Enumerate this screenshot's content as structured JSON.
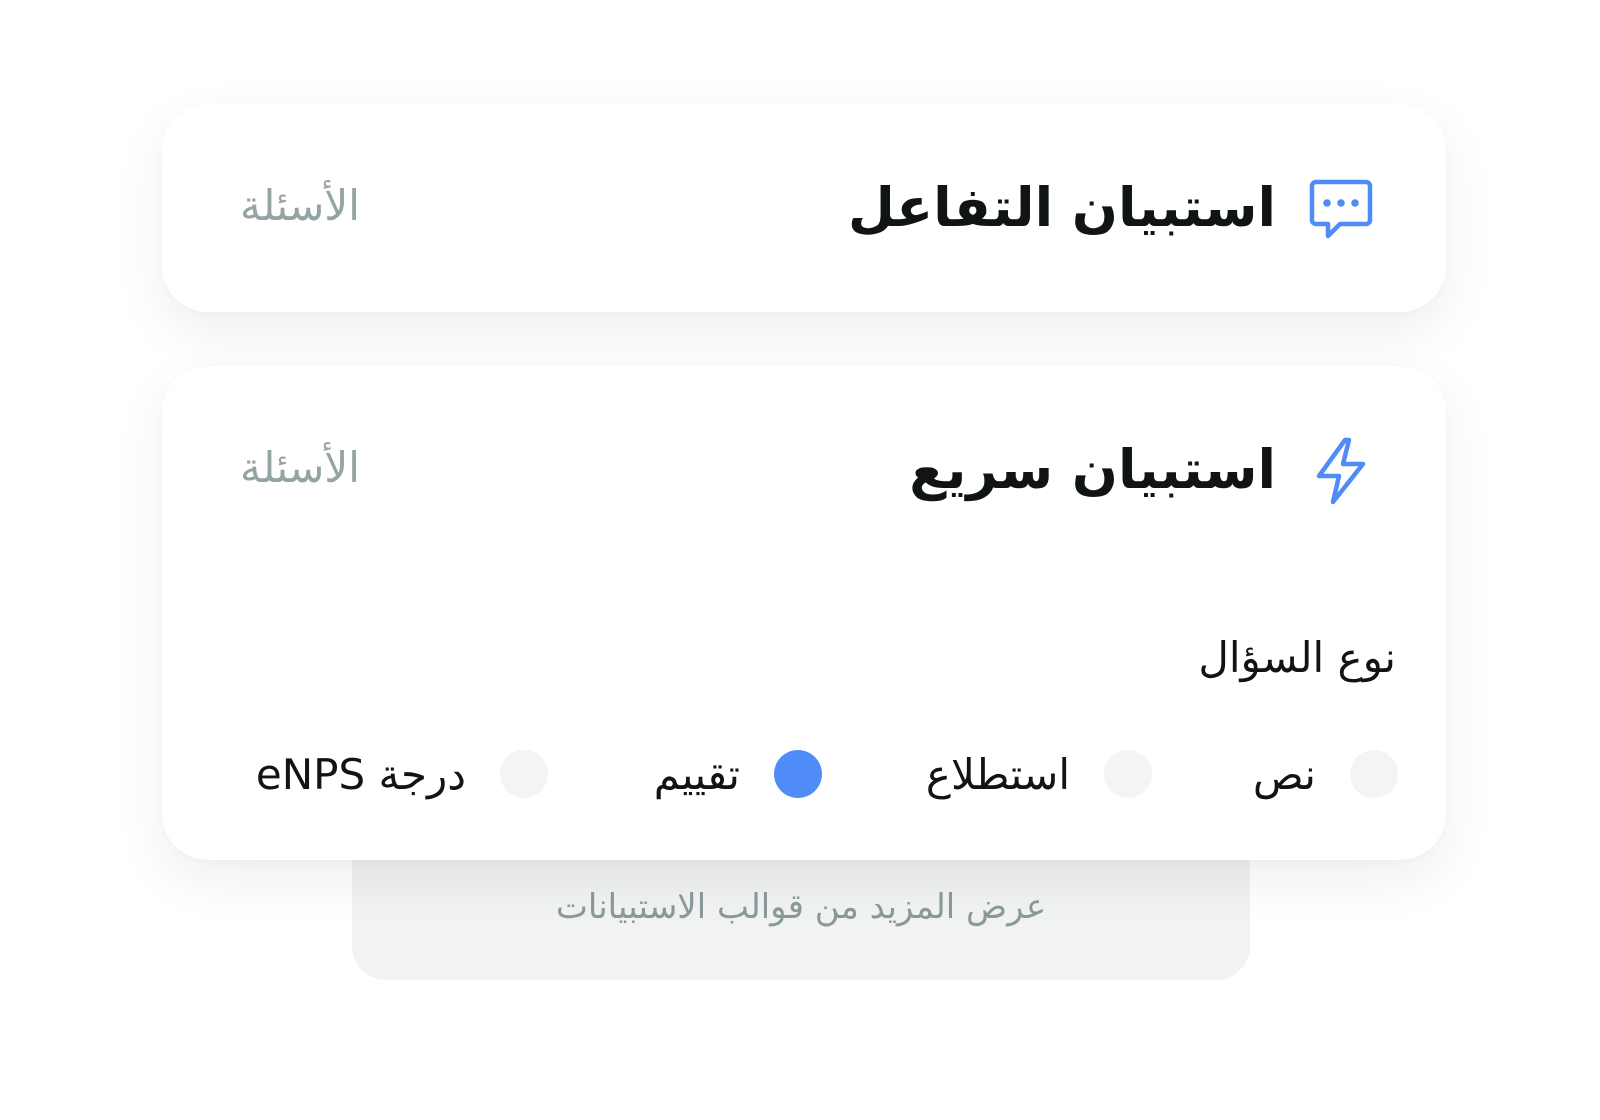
{
  "more_templates_label": "عرض المزيد من قوالب الاستبيانات",
  "cards": [
    {
      "title": "استبيان التفاعل",
      "meta": "الأسئلة",
      "icon": "chat-bubble-icon"
    },
    {
      "title": "استبيان سريع",
      "meta": "الأسئلة",
      "icon": "lightning-icon",
      "question_type_label": "نوع السؤال",
      "options": [
        {
          "label": "نص",
          "selected": false
        },
        {
          "label": "استطلاع",
          "selected": false
        },
        {
          "label": "تقييم",
          "selected": true
        },
        {
          "label": "درجة eNPS",
          "selected": false
        }
      ]
    }
  ],
  "colors": {
    "accent": "#4f8cf7",
    "muted_text": "#94a3a3",
    "radio_off": "#f3f4f4",
    "footer_bg": "#f1f2f2"
  }
}
